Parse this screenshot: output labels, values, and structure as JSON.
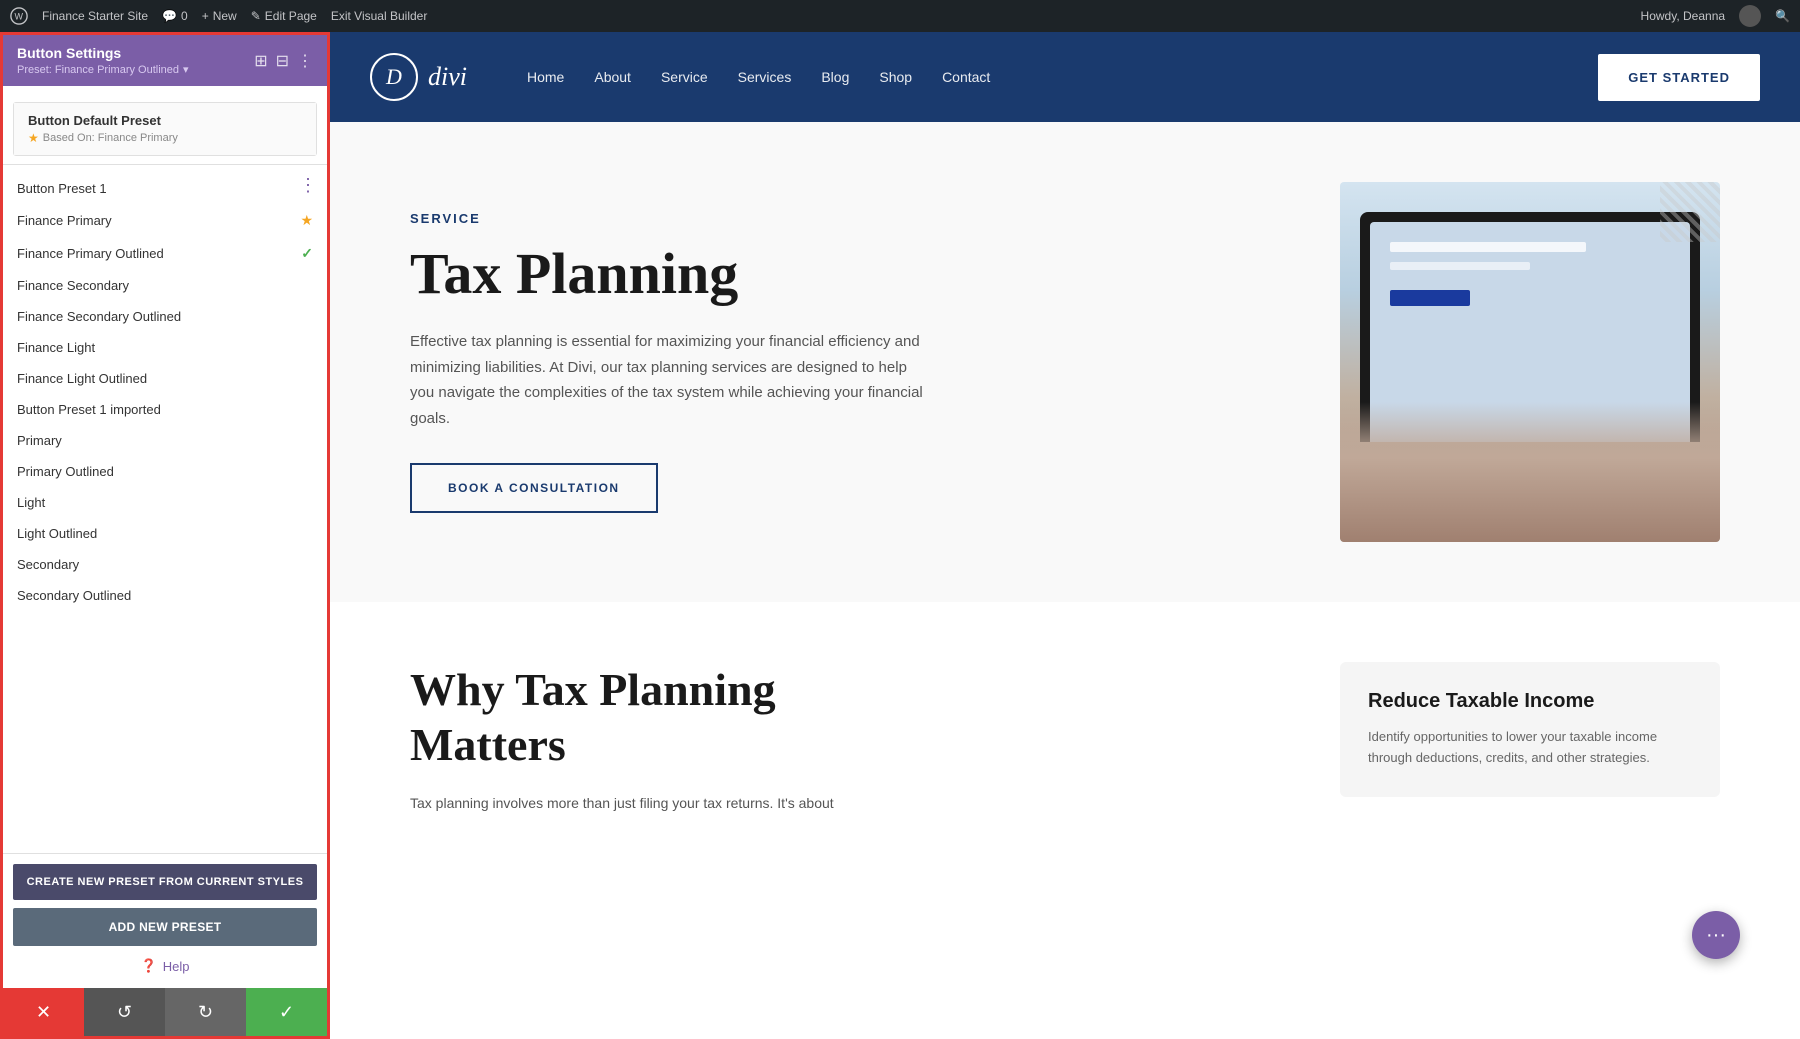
{
  "admin_bar": {
    "wp_label": "WordPress",
    "site_name": "Finance Starter Site",
    "comments_count": "0",
    "new_label": "New",
    "edit_page_label": "Edit Page",
    "exit_builder_label": "Exit Visual Builder",
    "howdy": "Howdy, Deanna",
    "search_placeholder": "Search"
  },
  "sidebar": {
    "title": "Button Settings",
    "preset_label": "Preset: Finance Primary Outlined",
    "preset_dropdown_icon": "▾",
    "default_preset": {
      "title": "Button Default Preset",
      "based_on": "Based On: Finance Primary"
    },
    "preset_items": [
      {
        "name": "Button Preset 1",
        "icon": ""
      },
      {
        "name": "Finance Primary",
        "icon": "star"
      },
      {
        "name": "Finance Primary Outlined",
        "icon": "check"
      },
      {
        "name": "Finance Secondary",
        "icon": ""
      },
      {
        "name": "Finance Secondary Outlined",
        "icon": ""
      },
      {
        "name": "Finance Light",
        "icon": ""
      },
      {
        "name": "Finance Light Outlined",
        "icon": ""
      },
      {
        "name": "Button Preset 1 imported",
        "icon": ""
      },
      {
        "name": "Primary",
        "icon": ""
      },
      {
        "name": "Primary Outlined",
        "icon": ""
      },
      {
        "name": "Light",
        "icon": ""
      },
      {
        "name": "Light Outlined",
        "icon": ""
      },
      {
        "name": "Secondary",
        "icon": ""
      },
      {
        "name": "Secondary Outlined",
        "icon": ""
      }
    ],
    "create_preset_label": "CREATE NEW PRESET FROM CURRENT STYLES",
    "add_preset_label": "ADD NEW PRESET",
    "help_label": "Help"
  },
  "bottom_bar": {
    "cancel_icon": "✕",
    "undo_icon": "↺",
    "redo_icon": "↻",
    "save_icon": "✓"
  },
  "site_nav": {
    "logo_letter": "D",
    "logo_name": "divi",
    "links": [
      "Home",
      "About",
      "Service",
      "Services",
      "Blog",
      "Shop",
      "Contact"
    ],
    "cta": "GET STARTED"
  },
  "hero": {
    "label": "SERVICE",
    "title": "Tax Planning",
    "description": "Effective tax planning is essential for maximizing your financial efficiency and minimizing liabilities. At Divi, our tax planning services are designed to help you navigate the complexities of the tax system while achieving your financial goals.",
    "cta": "BOOK A CONSULTATION"
  },
  "bottom": {
    "title_line1": "Why Tax Planning",
    "title_line2": "Matters",
    "description": "Tax planning involves more than just filing your tax returns. It's about",
    "card": {
      "title": "Reduce Taxable Income",
      "description": "Identify opportunities to lower your taxable income through deductions, credits, and other strategies."
    }
  },
  "fab": {
    "icon": "···"
  }
}
